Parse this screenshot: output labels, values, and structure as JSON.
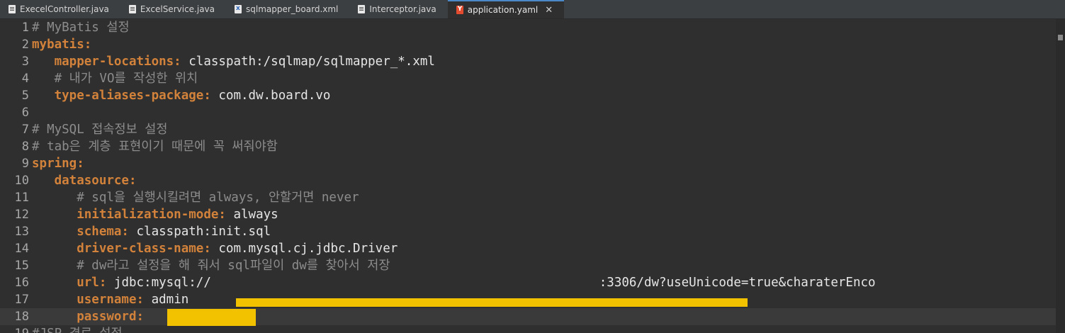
{
  "tabs": [
    {
      "name": "ExecelController.java",
      "type": "java",
      "active": false
    },
    {
      "name": "ExcelService.java",
      "type": "java",
      "active": false
    },
    {
      "name": "sqlmapper_board.xml",
      "type": "xml",
      "active": false
    },
    {
      "name": "Interceptor.java",
      "type": "java",
      "active": false
    },
    {
      "name": "application.yaml",
      "type": "yaml",
      "active": true
    }
  ],
  "lines": [
    {
      "n": "1",
      "indent": "",
      "key": "",
      "value": "",
      "comment": "# MyBatis 설정"
    },
    {
      "n": "2",
      "indent": "",
      "key": "mybatis:",
      "value": "",
      "comment": ""
    },
    {
      "n": "3",
      "indent": "   ",
      "key": "mapper-locations:",
      "value": " classpath:/sqlmap/sqlmapper_*.xml",
      "comment": ""
    },
    {
      "n": "4",
      "indent": "   ",
      "key": "",
      "value": "",
      "comment": "# 내가 VO를 작성한 위치"
    },
    {
      "n": "5",
      "indent": "   ",
      "key": "type-aliases-package:",
      "value": " com.dw.board.vo",
      "comment": ""
    },
    {
      "n": "6",
      "indent": "",
      "key": "",
      "value": "",
      "comment": ""
    },
    {
      "n": "7",
      "indent": "",
      "key": "",
      "value": "",
      "comment": "# MySQL 접속정보 설정"
    },
    {
      "n": "8",
      "indent": "",
      "key": "",
      "value": "",
      "comment": "# tab은 계층 표현이기 때문에 꼭 써줘야함"
    },
    {
      "n": "9",
      "indent": "",
      "key": "spring:",
      "value": "",
      "comment": ""
    },
    {
      "n": "10",
      "indent": "   ",
      "key": "datasource:",
      "value": "",
      "comment": ""
    },
    {
      "n": "11",
      "indent": "      ",
      "key": "",
      "value": "",
      "comment": "# sql을 실행시킬려면 always, 안할거면 never"
    },
    {
      "n": "12",
      "indent": "      ",
      "key": "initialization-mode:",
      "value": " always",
      "comment": ""
    },
    {
      "n": "13",
      "indent": "      ",
      "key": "schema:",
      "value": " classpath:init.sql",
      "comment": ""
    },
    {
      "n": "14",
      "indent": "      ",
      "key": "driver-class-name:",
      "value": " com.mysql.cj.jdbc.Driver",
      "comment": ""
    },
    {
      "n": "15",
      "indent": "      ",
      "key": "",
      "value": "",
      "comment": "# dw라고 설정을 해 줘서 sql파일이 dw를 찾아서 저장"
    },
    {
      "n": "16",
      "indent": "      ",
      "key": "url:",
      "value": " jdbc:mysql://                                                    :3306/dw?useUnicode=true&charaterEnco",
      "comment": ""
    },
    {
      "n": "17",
      "indent": "      ",
      "key": "username:",
      "value": " admin",
      "comment": ""
    },
    {
      "n": "18",
      "indent": "      ",
      "key": "password:",
      "value": "",
      "comment": ""
    },
    {
      "n": "19",
      "indent": "",
      "key": "",
      "value": "",
      "comment": "#JSP 경로 설정"
    }
  ],
  "colors": {
    "key": "#d2823a",
    "comment": "#8c8c8c",
    "redaction": "#f2c200",
    "active_tab_accent": "#4a88c7"
  },
  "icons": {
    "java": "java-file-icon",
    "xml": "xml-file-icon",
    "yaml": "yaml-file-icon",
    "close": "close-icon"
  }
}
